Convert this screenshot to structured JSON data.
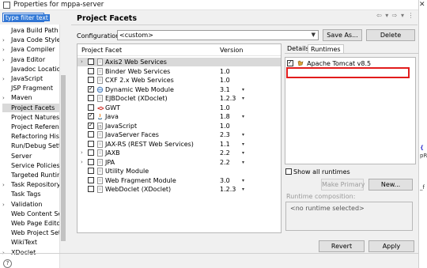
{
  "window": {
    "title": "Properties for mppa-server"
  },
  "filter": {
    "value": "type filter text"
  },
  "tree": {
    "items": [
      {
        "label": "Java Build Path"
      },
      {
        "label": "Java Code Style",
        "twisty": "›"
      },
      {
        "label": "Java Compiler",
        "twisty": "›"
      },
      {
        "label": "Java Editor",
        "twisty": "›"
      },
      {
        "label": "Javadoc Location"
      },
      {
        "label": "JavaScript",
        "twisty": "›"
      },
      {
        "label": "JSP Fragment"
      },
      {
        "label": "Maven",
        "twisty": "›"
      },
      {
        "label": "Project Facets",
        "selected": true
      },
      {
        "label": "Project Natures"
      },
      {
        "label": "Project References"
      },
      {
        "label": "Refactoring History"
      },
      {
        "label": "Run/Debug Settings"
      },
      {
        "label": "Server"
      },
      {
        "label": "Service Policies"
      },
      {
        "label": "Targeted Runtimes"
      },
      {
        "label": "Task Repository",
        "twisty": "›"
      },
      {
        "label": "Task Tags"
      },
      {
        "label": "Validation",
        "twisty": "›"
      },
      {
        "label": "Web Content Settings"
      },
      {
        "label": "Web Page Editor"
      },
      {
        "label": "Web Project Settings"
      },
      {
        "label": "WikiText"
      },
      {
        "label": "XDoclet",
        "twisty": "›"
      }
    ]
  },
  "page": {
    "title": "Project Facets"
  },
  "header_icons": "⇦ ▾ ⇨ ▾ ⋮",
  "config": {
    "label": "Configuration:",
    "value": "<custom>",
    "save_as": "Save As...",
    "delete": "Delete"
  },
  "facets": {
    "col_facet": "Project Facet",
    "col_version": "Version",
    "rows": [
      {
        "name": "Axis2 Web Services",
        "version": "",
        "checked": false,
        "twisty": "›",
        "highlight": true,
        "icon": "doc"
      },
      {
        "name": "Binder Web Services",
        "version": "1.0",
        "checked": false,
        "icon": "doc"
      },
      {
        "name": "CXF 2.x Web Services",
        "version": "1.0",
        "checked": false,
        "icon": "doc"
      },
      {
        "name": "Dynamic Web Module",
        "version": "3.1",
        "checked": true,
        "icon": "web",
        "dd": "▾"
      },
      {
        "name": "EJBDoclet (XDoclet)",
        "version": "1.2.3",
        "checked": false,
        "icon": "doc",
        "dd": "▾"
      },
      {
        "name": "GWT",
        "version": "1.0",
        "checked": false,
        "icon": "gwt"
      },
      {
        "name": "Java",
        "version": "1.8",
        "checked": true,
        "icon": "java",
        "dd": "▾"
      },
      {
        "name": "JavaScript",
        "version": "1.0",
        "checked": true,
        "icon": "js"
      },
      {
        "name": "JavaServer Faces",
        "version": "2.3",
        "checked": false,
        "icon": "doc",
        "dd": "▾"
      },
      {
        "name": "JAX-RS (REST Web Services)",
        "version": "1.1",
        "checked": false,
        "icon": "doc",
        "dd": "▾"
      },
      {
        "name": "JAXB",
        "version": "2.2",
        "checked": false,
        "icon": "doc",
        "dd": "▾",
        "twisty": "›"
      },
      {
        "name": "JPA",
        "version": "2.2",
        "checked": false,
        "icon": "doc",
        "dd": "▾",
        "twisty": "›"
      },
      {
        "name": "Utility Module",
        "version": "",
        "checked": false,
        "icon": "doc"
      },
      {
        "name": "Web Fragment Module",
        "version": "3.0",
        "checked": false,
        "icon": "doc",
        "dd": "▾"
      },
      {
        "name": "WebDoclet (XDoclet)",
        "version": "1.2.3",
        "checked": false,
        "icon": "doc",
        "dd": "▾"
      }
    ]
  },
  "tabs": {
    "details": "Details",
    "runtimes": "Runtimes"
  },
  "runtimes": {
    "items": [
      {
        "name": "Apache Tomcat v8.5",
        "checked": true
      }
    ],
    "show_all": "Show all runtimes",
    "make_primary": "Make Primary",
    "new": "New...",
    "composition_label": "Runtime composition:",
    "composition_value": "<no runtime selected>"
  },
  "buttons": {
    "revert": "Revert",
    "apply": "Apply"
  },
  "background": {
    "close_glyph": "✕",
    "fragments": [
      "{",
      "pRe",
      "_f"
    ]
  }
}
